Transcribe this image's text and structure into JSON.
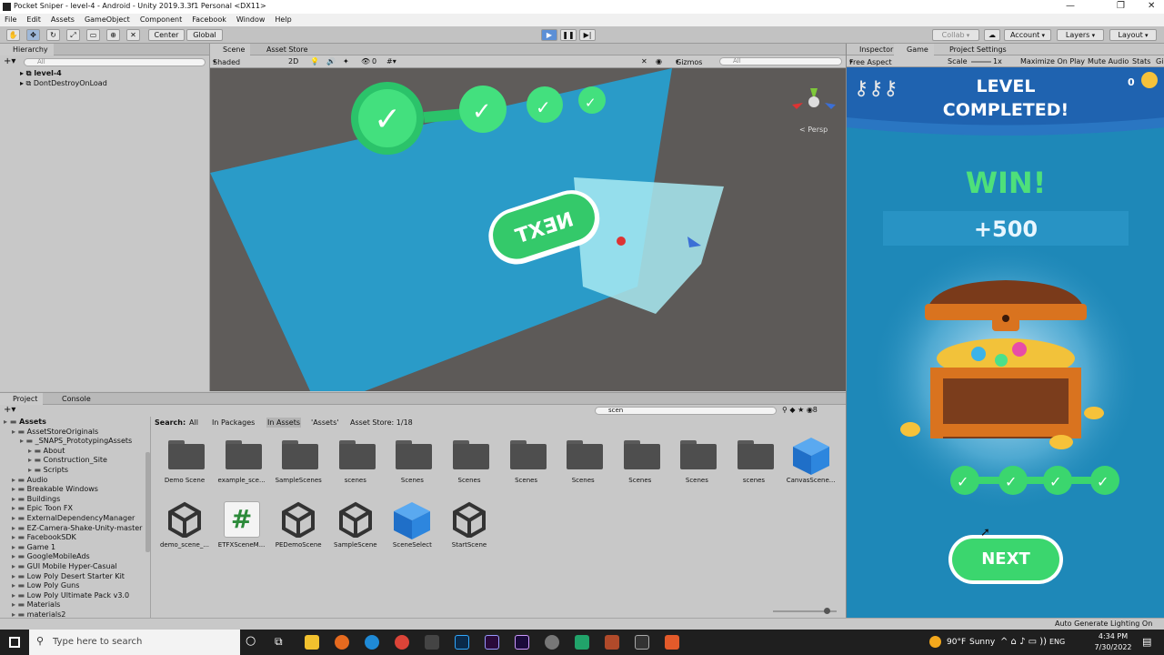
{
  "window": {
    "title": "Pocket Sniper - level-4 - Android - Unity 2019.3.3f1 Personal <DX11>"
  },
  "menu": [
    "File",
    "Edit",
    "Assets",
    "GameObject",
    "Component",
    "Facebook",
    "Window",
    "Help"
  ],
  "toolbar": {
    "pivot": "Center",
    "space": "Global",
    "collab": "Collab",
    "account": "Account",
    "layers": "Layers",
    "layout": "Layout"
  },
  "hierarchy": {
    "tab": "Hierarchy",
    "search_placeholder": "All",
    "items": [
      "level-4",
      "DontDestroyOnLoad"
    ]
  },
  "scene": {
    "tabs": [
      "Scene",
      "Asset Store"
    ],
    "shading": "Shaded",
    "mode2d": "2D",
    "gizmo_count": "0",
    "gizmos": "Gizmos",
    "search_placeholder": "All",
    "persp": "< Persp",
    "next_button_mirrored": "TXƎИ"
  },
  "project": {
    "tabs": [
      "Project",
      "Console"
    ],
    "search_value": "scen",
    "badge": "8",
    "filter": {
      "label": "Search:",
      "opts": [
        "All",
        "In Packages",
        "In Assets",
        "'Assets'",
        "Asset Store: 1/18"
      ]
    },
    "tree": [
      {
        "l": "Assets",
        "d": 0,
        "b": true
      },
      {
        "l": "AssetStoreOriginals",
        "d": 1
      },
      {
        "l": "_SNAPS_PrototypingAssets",
        "d": 2
      },
      {
        "l": "About",
        "d": 3
      },
      {
        "l": "Construction_Site",
        "d": 3
      },
      {
        "l": "Scripts",
        "d": 3
      },
      {
        "l": "Audio",
        "d": 1
      },
      {
        "l": "Breakable Windows",
        "d": 1
      },
      {
        "l": "Buildings",
        "d": 1
      },
      {
        "l": "Epic Toon FX",
        "d": 1
      },
      {
        "l": "ExternalDependencyManager",
        "d": 1
      },
      {
        "l": "EZ-Camera-Shake-Unity-master",
        "d": 1
      },
      {
        "l": "FacebookSDK",
        "d": 1
      },
      {
        "l": "Game 1",
        "d": 1
      },
      {
        "l": "GoogleMobileAds",
        "d": 1
      },
      {
        "l": "GUI Mobile Hyper-Casual",
        "d": 1
      },
      {
        "l": "Low Poly Desert Starter Kit",
        "d": 1
      },
      {
        "l": "Low Poly Guns",
        "d": 1
      },
      {
        "l": "Low Poly Ultimate Pack v3.0",
        "d": 1
      },
      {
        "l": "Materials",
        "d": 1
      },
      {
        "l": "materials2",
        "d": 1
      }
    ],
    "assets_row1": [
      {
        "l": "Demo Scene",
        "t": "folder"
      },
      {
        "l": "example_sce...",
        "t": "folder"
      },
      {
        "l": "SampleScenes",
        "t": "folder"
      },
      {
        "l": "scenes",
        "t": "folder"
      },
      {
        "l": "Scenes",
        "t": "folder"
      },
      {
        "l": "Scenes",
        "t": "folder"
      },
      {
        "l": "Scenes",
        "t": "folder"
      },
      {
        "l": "Scenes",
        "t": "folder"
      },
      {
        "l": "Scenes",
        "t": "folder"
      },
      {
        "l": "Scenes",
        "t": "folder"
      },
      {
        "l": "scenes",
        "t": "folder"
      },
      {
        "l": "CanvasScene...",
        "t": "cube"
      }
    ],
    "assets_row2": [
      {
        "l": "demo_scene_...",
        "t": "unity"
      },
      {
        "l": "ETFXSceneM...",
        "t": "script"
      },
      {
        "l": "PEDemoScene",
        "t": "unity"
      },
      {
        "l": "SampleScene",
        "t": "unity"
      },
      {
        "l": "SceneSelect",
        "t": "cube"
      },
      {
        "l": "StartScene",
        "t": "unity"
      }
    ]
  },
  "game": {
    "tabs": [
      "Inspector",
      "Game",
      "Project Settings"
    ],
    "aspect": "Free Aspect",
    "scale_label": "Scale",
    "scale_value": "1x",
    "options": [
      "Maximize On Play",
      "Mute Audio",
      "Stats",
      "Gi"
    ],
    "coins": "0",
    "title_line1": "LEVEL",
    "title_line2": "COMPLETED!",
    "win": "WIN!",
    "reward": "+500",
    "next": "NEXT"
  },
  "status": {
    "right": "Auto Generate Lighting On"
  },
  "taskbar": {
    "search_placeholder": "Type here to search",
    "weather_temp": "90°F",
    "weather_text": "Sunny",
    "lang": "ENG",
    "time": "4:34 PM",
    "date": "7/30/2022"
  },
  "colors": {
    "panel": "#c8c8c8",
    "game_bg": "#1e88b8",
    "green": "#3ed46b",
    "title_blue": "#1a5ca8"
  }
}
